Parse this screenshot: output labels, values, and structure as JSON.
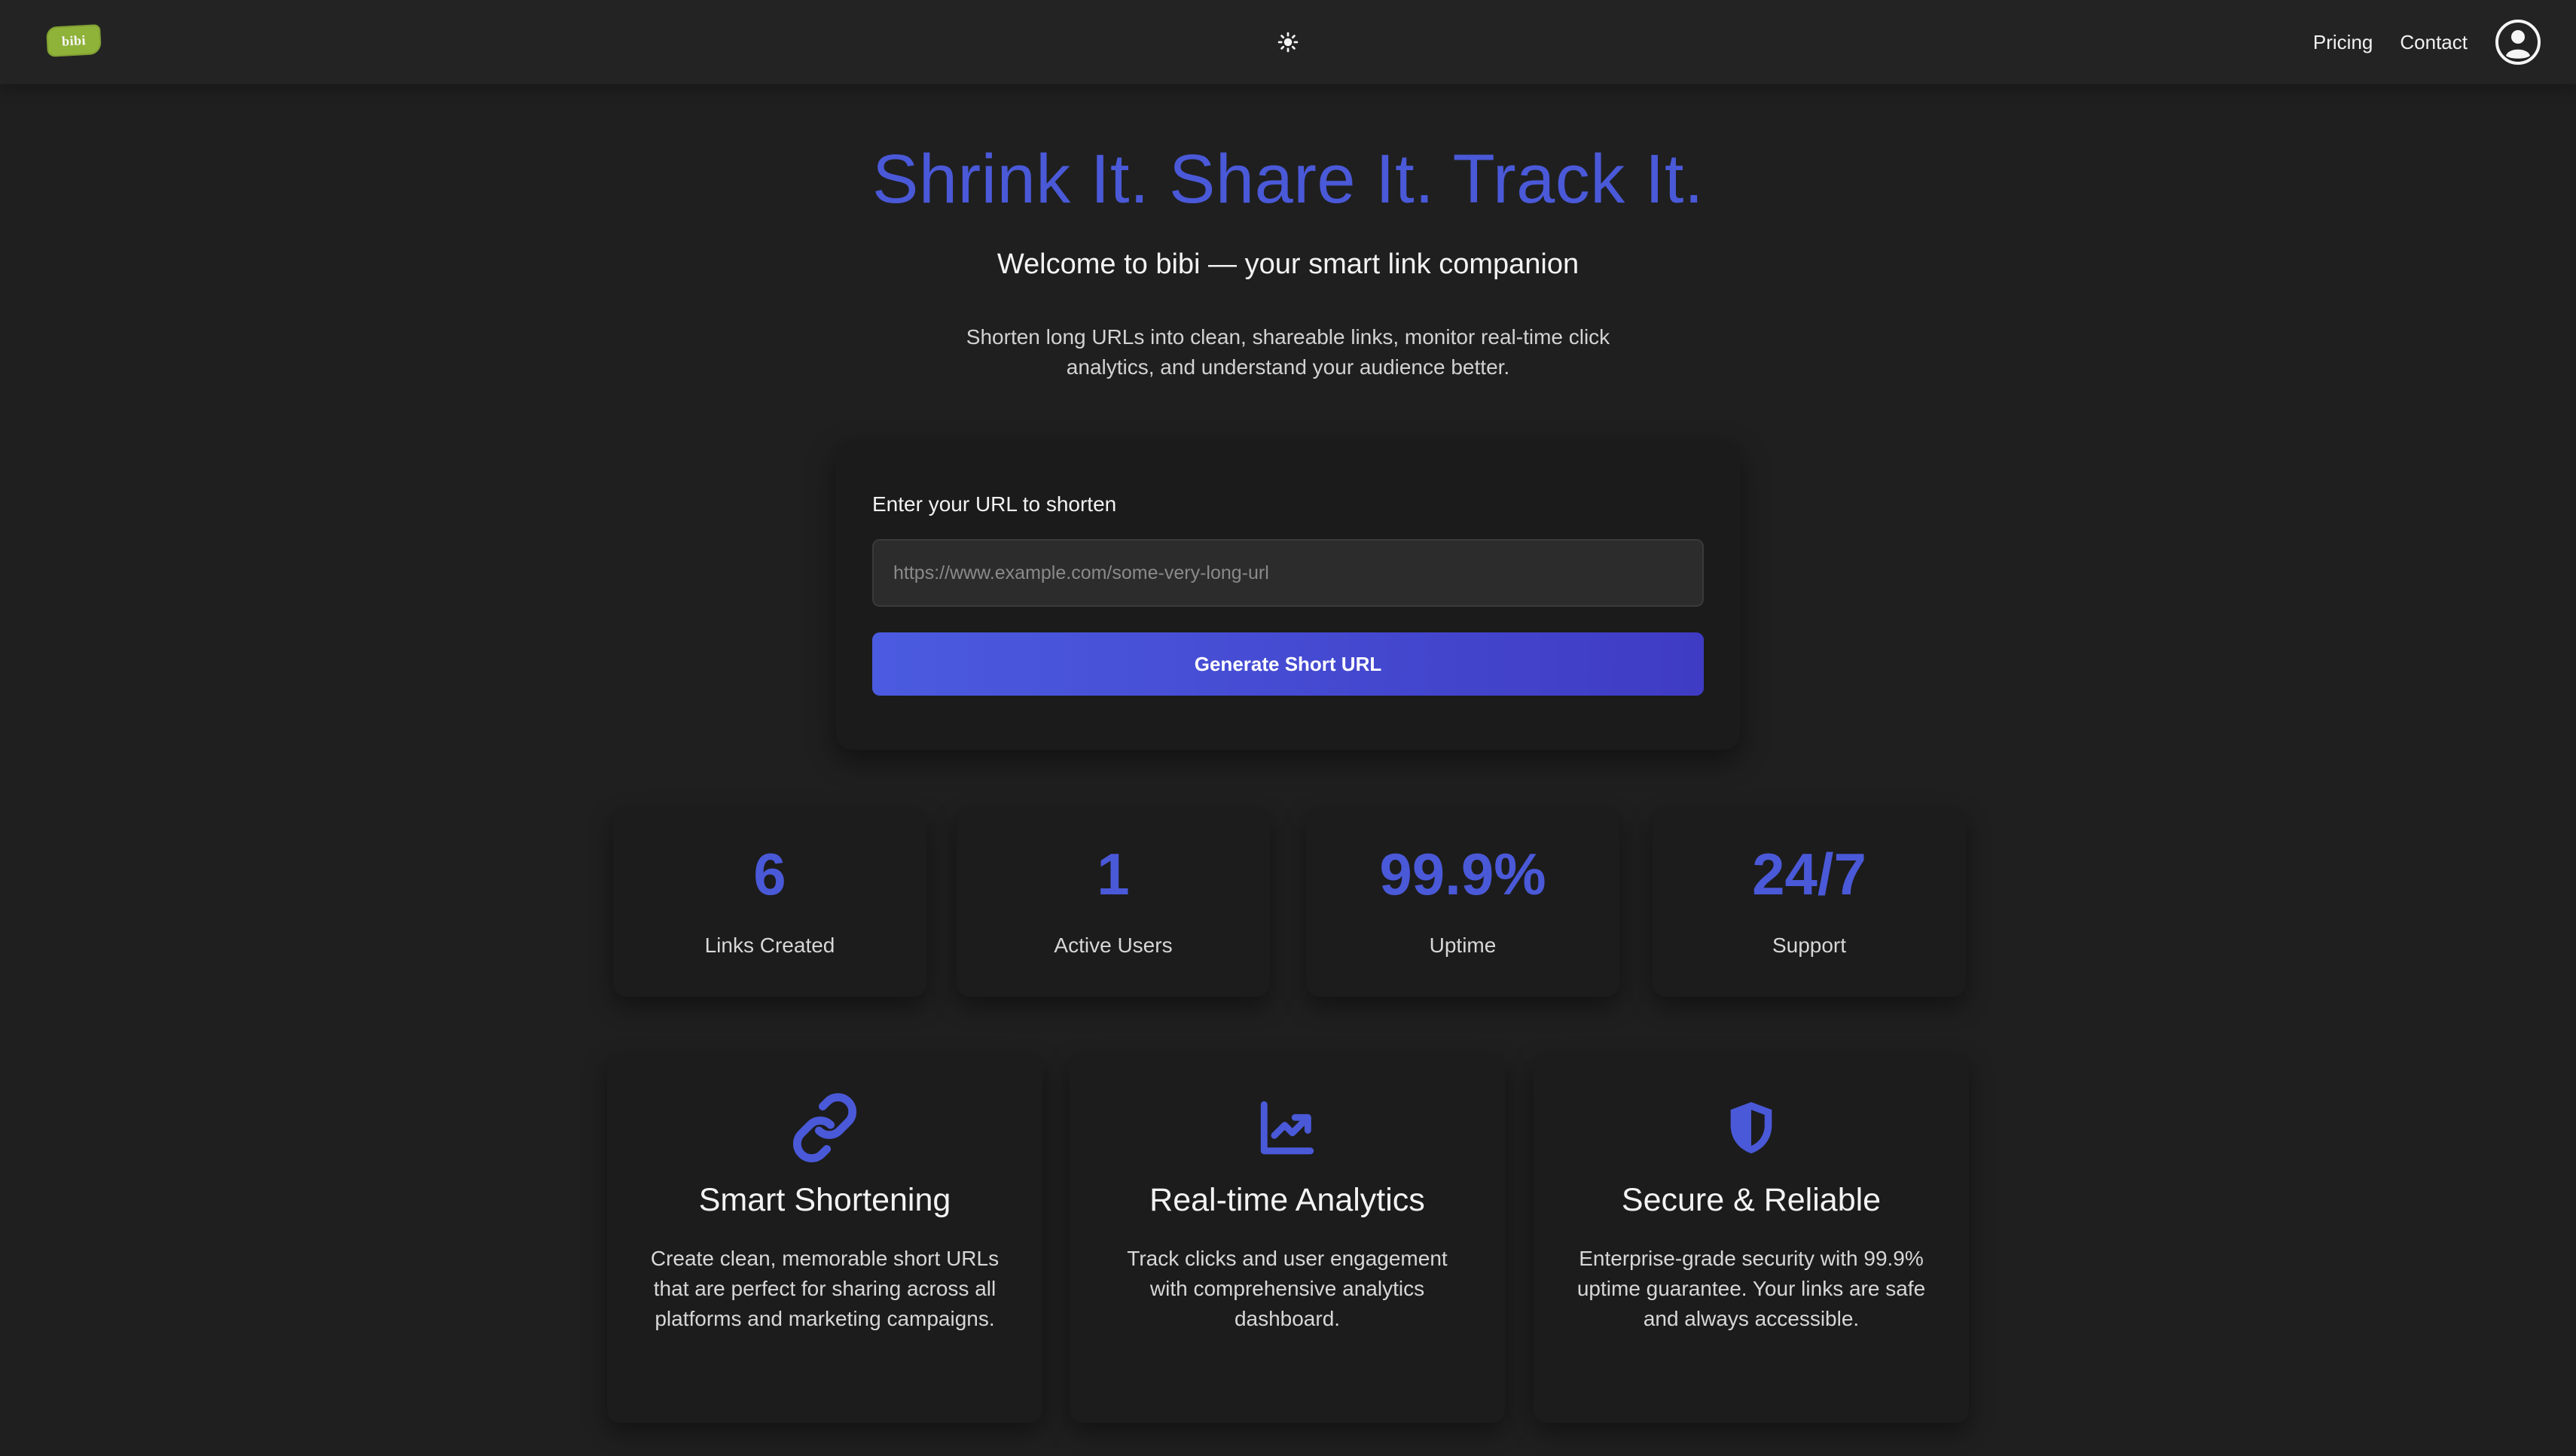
{
  "header": {
    "logo_text": "bibi",
    "theme_icon": "sun-icon",
    "nav": {
      "pricing": "Pricing",
      "contact": "Contact"
    },
    "avatar_icon": "user-circle-icon"
  },
  "hero": {
    "title": "Shrink It. Share It. Track It.",
    "subtitle": "Welcome to bibi — your smart link companion",
    "description": "Shorten long URLs into clean, shareable links, monitor real-time click analytics, and understand your audience better."
  },
  "form": {
    "label": "Enter your URL to shorten",
    "placeholder": "https://www.example.com/some-very-long-url",
    "value": "",
    "button_label": "Generate Short URL"
  },
  "stats": [
    {
      "value": "6",
      "label": "Links Created"
    },
    {
      "value": "1",
      "label": "Active Users"
    },
    {
      "value": "99.9%",
      "label": "Uptime"
    },
    {
      "value": "24/7",
      "label": "Support"
    }
  ],
  "features": [
    {
      "icon": "link-icon",
      "title": "Smart Shortening",
      "description": "Create clean, memorable short URLs that are perfect for sharing across all platforms and marketing campaigns."
    },
    {
      "icon": "chart-line-icon",
      "title": "Real-time Analytics",
      "description": "Track clicks and user engagement with comprehensive analytics dashboard."
    },
    {
      "icon": "shield-icon",
      "title": "Secure & Reliable",
      "description": "Enterprise-grade security with 99.9% uptime guarantee. Your links are safe and always accessible."
    }
  ],
  "colors": {
    "background": "#1f1f1f",
    "header": "#232323",
    "accent": "#4a59d8",
    "button_start": "#4b5be0",
    "button_end": "#3f3bc4",
    "logo": "#8fb239"
  }
}
